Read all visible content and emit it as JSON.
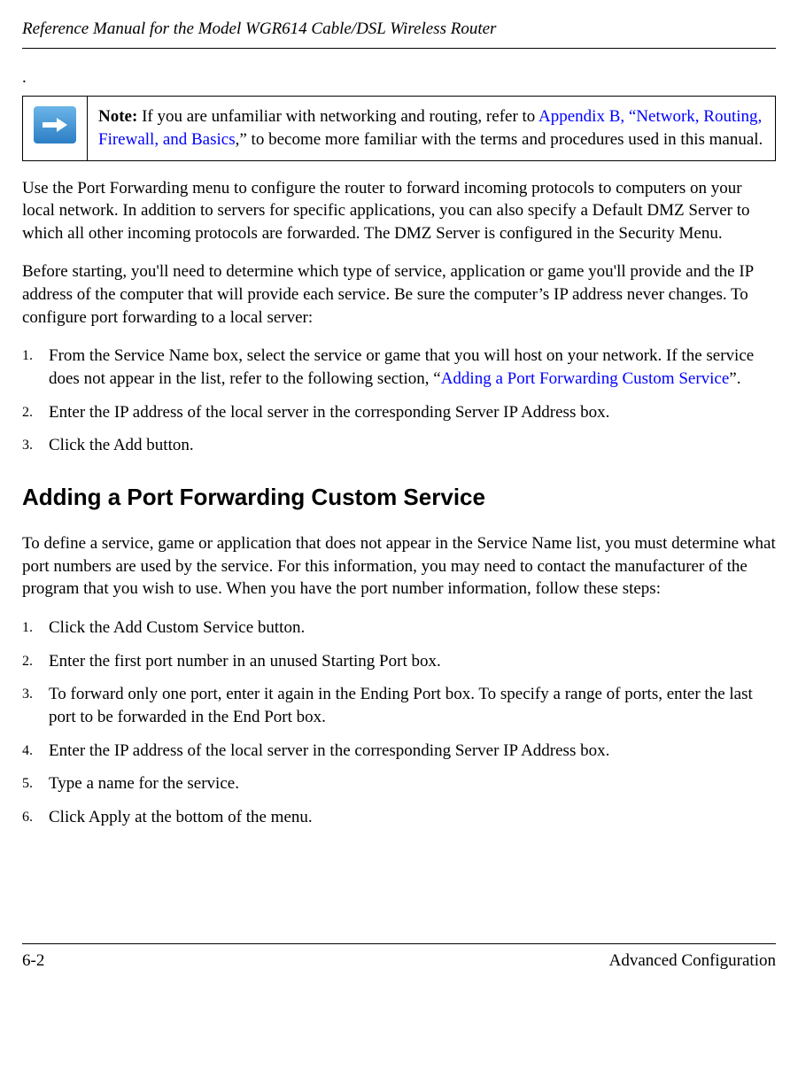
{
  "header": {
    "title": "Reference Manual for the Model WGR614 Cable/DSL Wireless Router"
  },
  "note": {
    "label": "Note:",
    "text_before_link": " If you are unfamiliar with networking and routing, refer to ",
    "link_text": "Appendix B, “Network, Routing, Firewall, and Basics",
    "text_after_link": ",” to become more familiar with the terms and procedures used in this manual."
  },
  "intro_para": "Use the Port Forwarding menu to configure the router to forward incoming protocols to computers on your local network. In addition to servers for specific applications, you can also specify a Default DMZ Server to which all other incoming protocols are forwarded. The DMZ Server is configured in the Security Menu.",
  "before_para": "Before starting, you'll need to determine which type of service, application or game you'll provide and the IP address of the computer that will provide each service. Be sure the computer’s IP address never changes. To configure port forwarding to a local server:",
  "list1": {
    "item1_a": "From the Service Name box, select the service or game that you will host on your network. If the service does not appear in the list, refer to the following section, “",
    "item1_link": "Adding a Port Forwarding Custom Service",
    "item1_b": "”.",
    "item2": "Enter the IP address of the local server in the corresponding Server IP Address box.",
    "item3": "Click the Add button."
  },
  "heading2": "Adding a Port Forwarding Custom Service",
  "custom_para": "To define a service, game or application that does not appear in the Service Name list, you must determine what port numbers are used by the service. For this information, you may need to contact the manufacturer of the program that you wish to use. When you have the port number information, follow these steps:",
  "list2": {
    "item1": "Click the Add Custom Service button.",
    "item2": "Enter the first port number in an unused Starting Port box.",
    "item3": "To forward only one port, enter it again in the Ending Port box. To specify a range of ports, enter the last port to be forwarded in the End Port box.",
    "item4": "Enter the IP address of the local server in the corresponding Server IP Address box.",
    "item5": "Type a name for the service.",
    "item6": "Click Apply at the bottom of the menu."
  },
  "footer": {
    "page": "6-2",
    "section": "Advanced Configuration"
  }
}
